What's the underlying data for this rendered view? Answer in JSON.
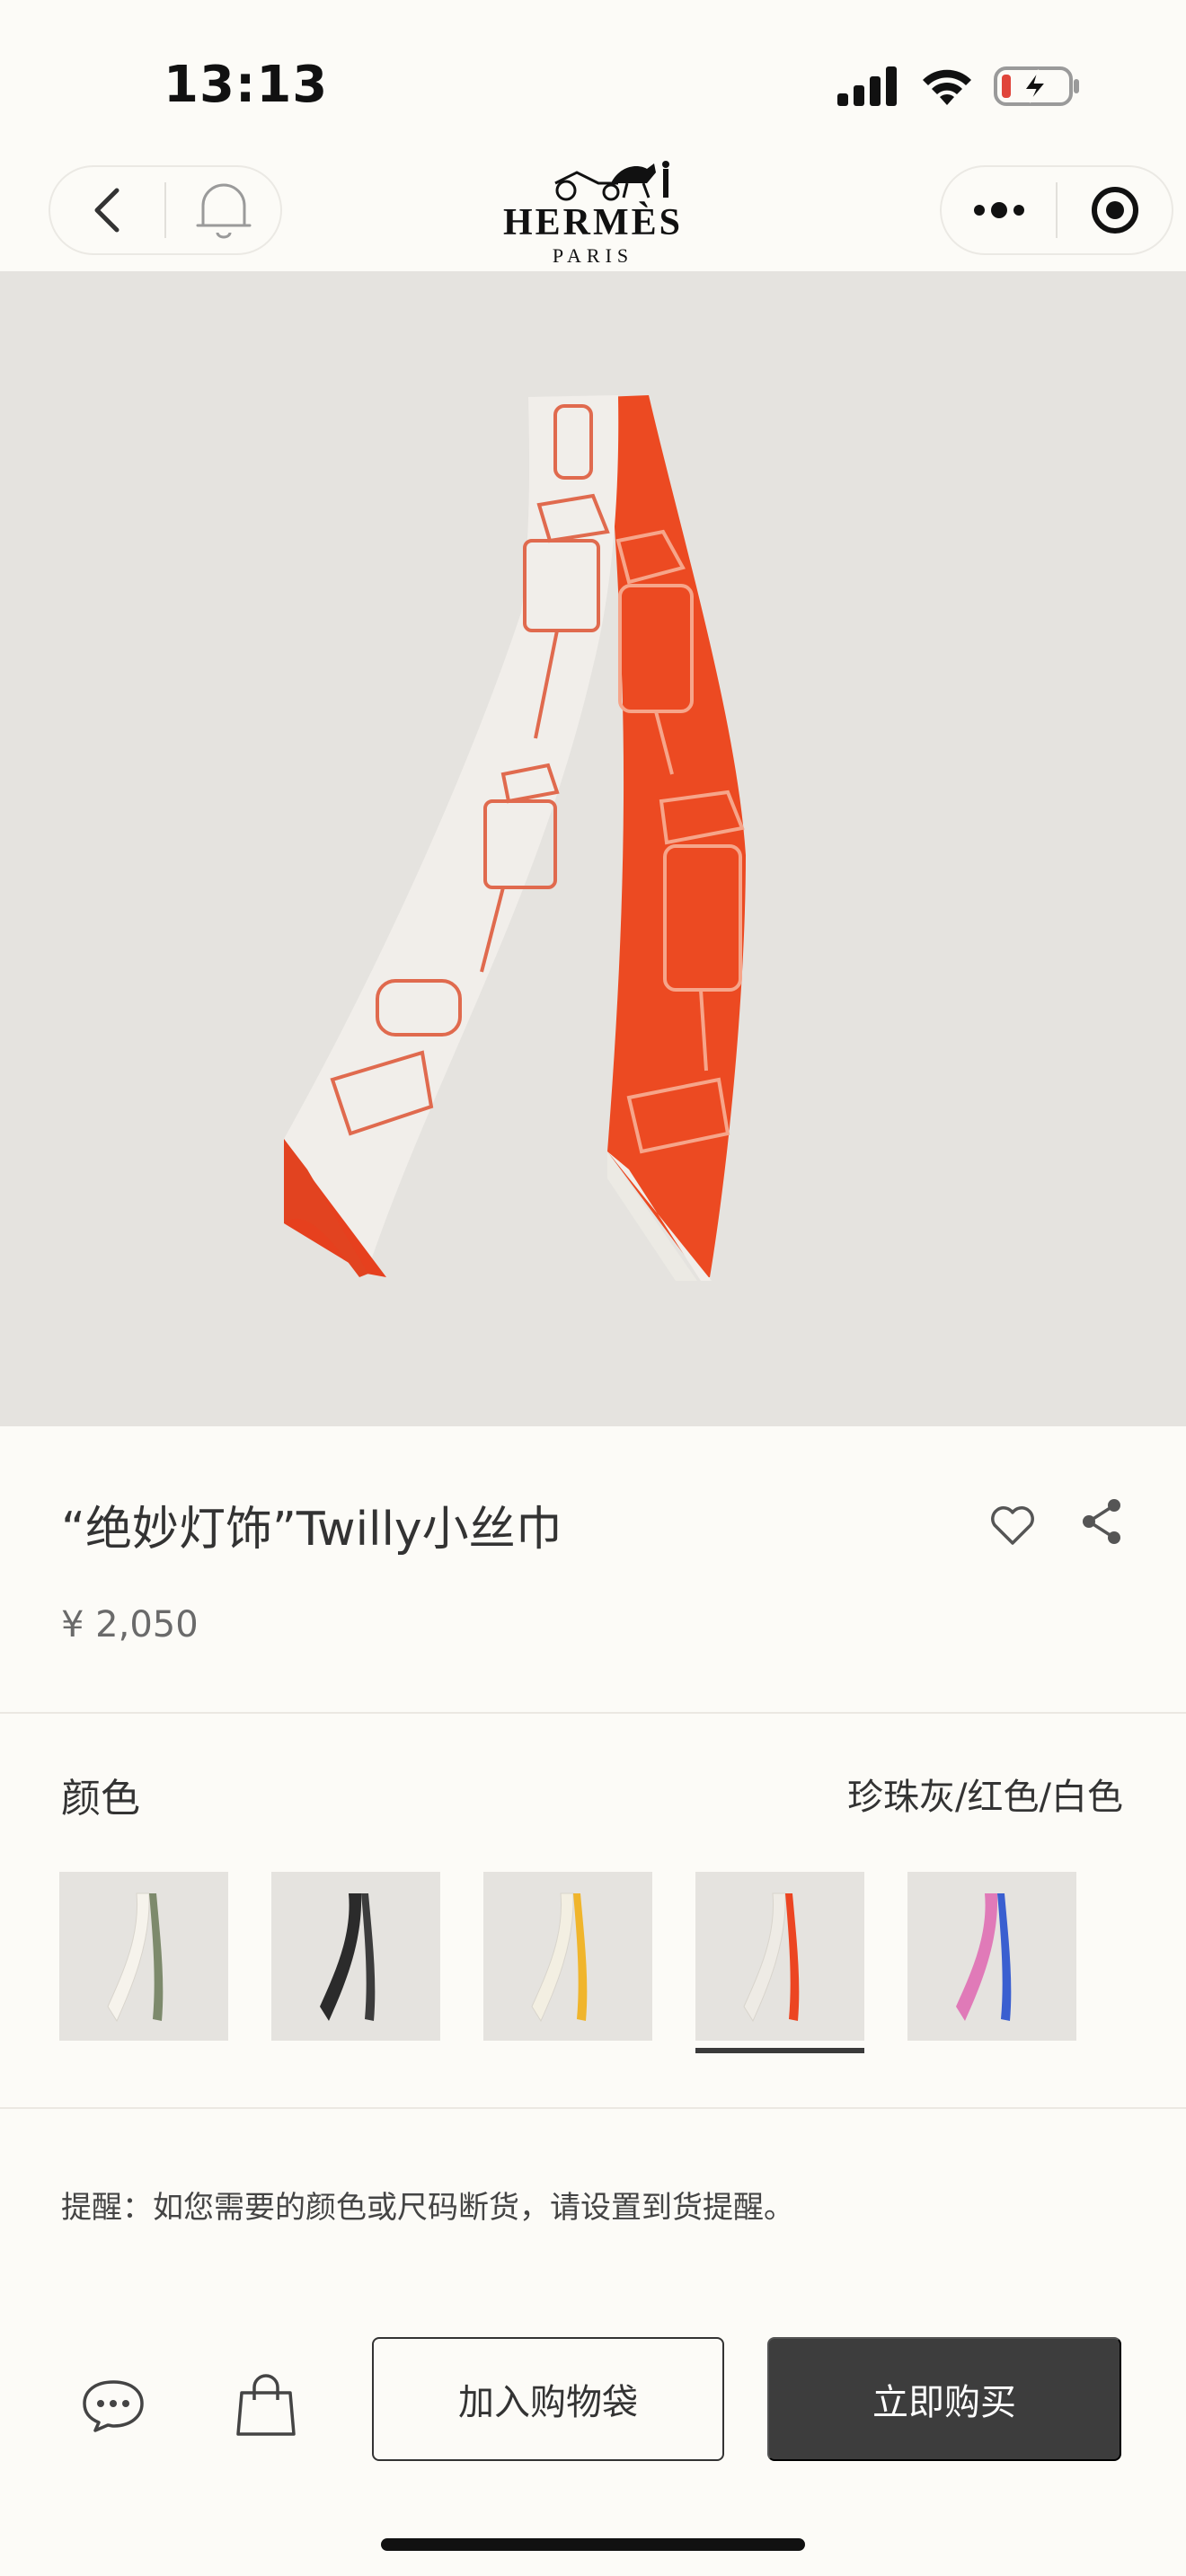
{
  "status_bar": {
    "time": "13:13",
    "icons": [
      "signal-icon",
      "wifi-icon",
      "battery-charging-icon"
    ],
    "battery_color": "#e0453a"
  },
  "nav": {
    "brand": "HERMÈS",
    "brand_sub": "PARIS",
    "left_icons": [
      "back-arrow-icon",
      "bell-icon"
    ],
    "right_icons": [
      "more-dots-icon",
      "target-icon"
    ]
  },
  "gallery": {
    "image_count": 3,
    "active_index": 0
  },
  "product": {
    "title": "“绝妙灯饰”Twilly小丝巾",
    "price": "¥ 2,050"
  },
  "color": {
    "label": "颜色",
    "selected_name": "珍珠灰/红色/白色",
    "swatches": [
      {
        "colors": [
          "#f2efe8",
          "#7d8a6c"
        ],
        "selected": false
      },
      {
        "colors": [
          "#2b2b2b",
          "#6a6a6a"
        ],
        "selected": false
      },
      {
        "colors": [
          "#f3efe2",
          "#f0b52c"
        ],
        "selected": false
      },
      {
        "colors": [
          "#eeebe5",
          "#ec4522"
        ],
        "selected": true
      },
      {
        "colors": [
          "#e07ab8",
          "#3a5fd0"
        ],
        "selected": false
      }
    ]
  },
  "reminder": "提醒：如您需要的颜色或尺码断货，请设置到货提醒。",
  "bottom_bar": {
    "chat_icon": "chat-bubble-icon",
    "bag_icon": "shopping-bag-icon",
    "add_to_bag_label": "加入购物袋",
    "buy_now_label": "立即购买"
  },
  "colors": {
    "background": "#fcfbf7",
    "image_bg": "#e5e3df",
    "accent_red": "#ec4522",
    "button_dark": "#3d3d3d"
  }
}
